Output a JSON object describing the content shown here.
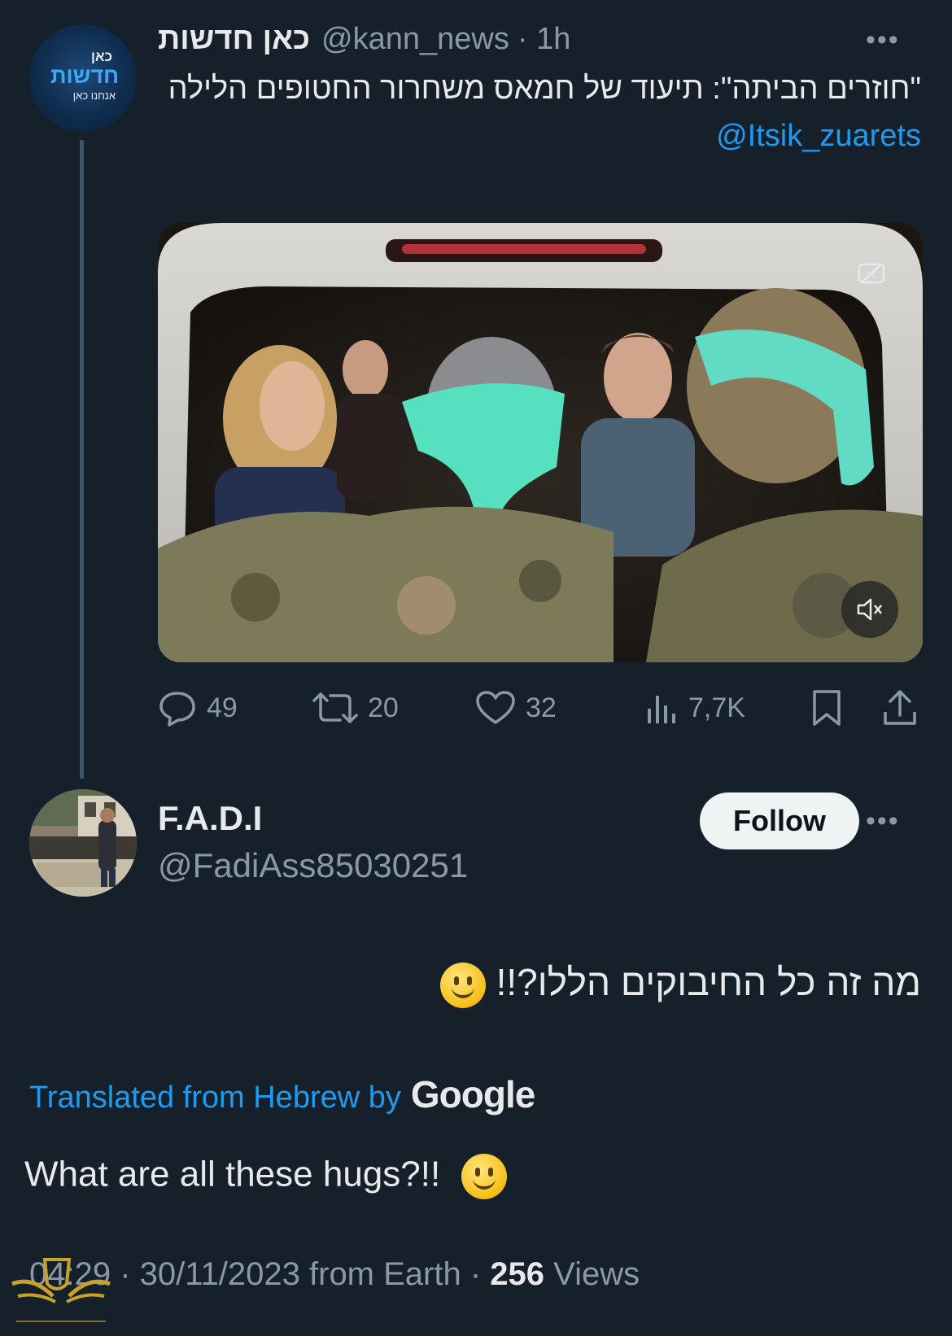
{
  "parent_tweet": {
    "avatar_lines": [
      "כאן",
      "חדשות",
      "אנחנו כאן"
    ],
    "display_name": "כאן חדשות",
    "handle": "@kann_news",
    "time": "· 1h",
    "more": "•••",
    "text": "\"חוזרים הביתה\": תיעוד של חמאס משחרור החטופים הלילה",
    "mention": "@Itsik_zuarets",
    "media": {
      "cc_icon": "closed-captions-icon",
      "mute_icon": "mute-icon"
    },
    "actions": {
      "replies": "49",
      "retweets": "20",
      "likes": "32",
      "views": "7,7K"
    }
  },
  "reply": {
    "display_name": "F.A.D.I",
    "handle": "@FadiAss85030251",
    "follow_label": "Follow",
    "more": "•••",
    "text": "מה זה כל החיבוקים הללו?!!",
    "translated_label": "Translated from Hebrew by",
    "translated_by": "Google",
    "translation": "What are all these hugs?!!",
    "meta": {
      "time": "04:29",
      "sep1": " · ",
      "date": "30/11/2023",
      "from": " from Earth · ",
      "views": "256",
      "views_label": " Views"
    }
  },
  "colors": {
    "background": "#15202b",
    "accent": "#1d9bf0",
    "secondary_text": "#8b98a5",
    "primary_text": "#e7e9ea"
  }
}
